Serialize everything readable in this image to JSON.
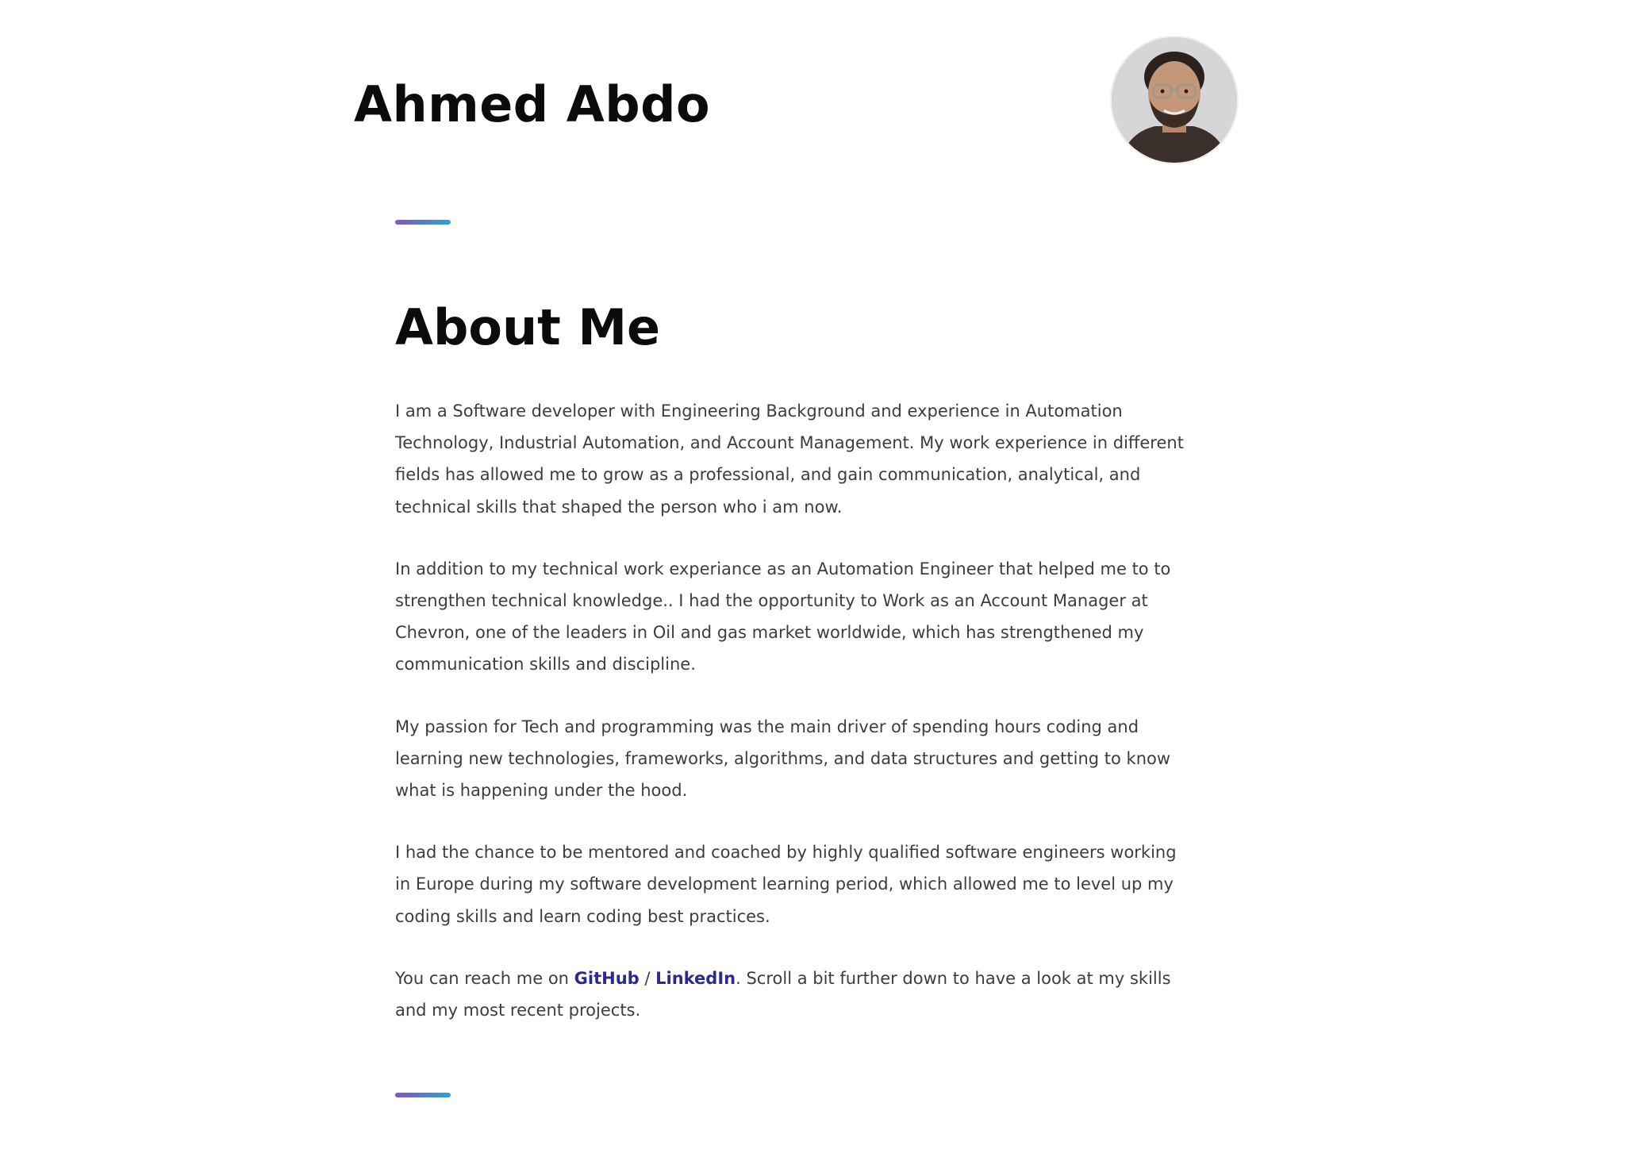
{
  "header": {
    "name": "Ahmed Abdo"
  },
  "avatar": {
    "icon": "profile-photo"
  },
  "about": {
    "title": "About Me",
    "paragraphs": [
      "I am a Software developer with Engineering Background and experience in Automation Technology, Industrial Automation, and Account Management. My work experience in different fields has allowed me to grow as a professional, and gain communication, analytical, and technical skills that shaped the person who i am now.",
      "In addition to my technical work experiance as an Automation Engineer that helped me to to strengthen technical knowledge.. I had the opportunity to Work as an Account Manager at Chevron, one of the leaders in Oil and gas market worldwide, which has strengthened my communication skills and discipline.",
      "My passion for Tech and programming was the main driver of spending hours coding and learning new technologies, frameworks, algorithms, and data structures and getting to know what is happening under the hood.",
      "I had the chance to be mentored and coached by highly qualified software engineers working in Europe during my software development learning period, which allowed me to level up my coding skills and learn coding best practices."
    ],
    "contact": {
      "prefix": "You can reach me on ",
      "github_label": "GitHub",
      "separator": " / ",
      "linkedin_label": "LinkedIn",
      "suffix": ". Scroll a bit further down to have a look at my skills and my most recent projects."
    }
  },
  "colors": {
    "heading": "#0b0b0b",
    "body_text": "#3d3d3d",
    "link": "#2b2b8f",
    "divider_start": "#7e57c2",
    "divider_end": "#2ba3d4"
  }
}
